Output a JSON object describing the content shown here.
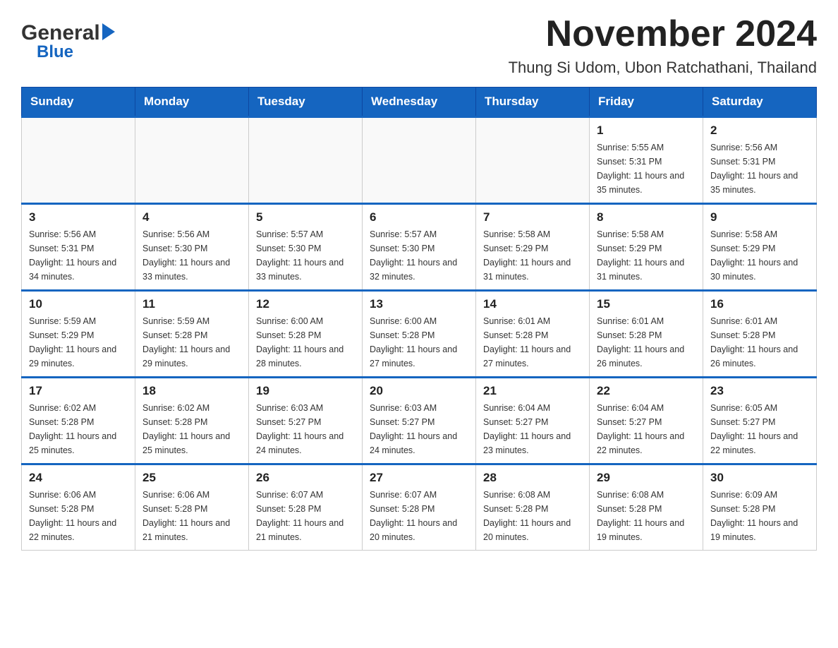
{
  "header": {
    "logo_general": "General",
    "logo_blue": "Blue",
    "title": "November 2024",
    "subtitle": "Thung Si Udom, Ubon Ratchathani, Thailand"
  },
  "calendar": {
    "days_of_week": [
      "Sunday",
      "Monday",
      "Tuesday",
      "Wednesday",
      "Thursday",
      "Friday",
      "Saturday"
    ],
    "weeks": [
      [
        {
          "day": "",
          "info": ""
        },
        {
          "day": "",
          "info": ""
        },
        {
          "day": "",
          "info": ""
        },
        {
          "day": "",
          "info": ""
        },
        {
          "day": "",
          "info": ""
        },
        {
          "day": "1",
          "info": "Sunrise: 5:55 AM\nSunset: 5:31 PM\nDaylight: 11 hours and 35 minutes."
        },
        {
          "day": "2",
          "info": "Sunrise: 5:56 AM\nSunset: 5:31 PM\nDaylight: 11 hours and 35 minutes."
        }
      ],
      [
        {
          "day": "3",
          "info": "Sunrise: 5:56 AM\nSunset: 5:31 PM\nDaylight: 11 hours and 34 minutes."
        },
        {
          "day": "4",
          "info": "Sunrise: 5:56 AM\nSunset: 5:30 PM\nDaylight: 11 hours and 33 minutes."
        },
        {
          "day": "5",
          "info": "Sunrise: 5:57 AM\nSunset: 5:30 PM\nDaylight: 11 hours and 33 minutes."
        },
        {
          "day": "6",
          "info": "Sunrise: 5:57 AM\nSunset: 5:30 PM\nDaylight: 11 hours and 32 minutes."
        },
        {
          "day": "7",
          "info": "Sunrise: 5:58 AM\nSunset: 5:29 PM\nDaylight: 11 hours and 31 minutes."
        },
        {
          "day": "8",
          "info": "Sunrise: 5:58 AM\nSunset: 5:29 PM\nDaylight: 11 hours and 31 minutes."
        },
        {
          "day": "9",
          "info": "Sunrise: 5:58 AM\nSunset: 5:29 PM\nDaylight: 11 hours and 30 minutes."
        }
      ],
      [
        {
          "day": "10",
          "info": "Sunrise: 5:59 AM\nSunset: 5:29 PM\nDaylight: 11 hours and 29 minutes."
        },
        {
          "day": "11",
          "info": "Sunrise: 5:59 AM\nSunset: 5:28 PM\nDaylight: 11 hours and 29 minutes."
        },
        {
          "day": "12",
          "info": "Sunrise: 6:00 AM\nSunset: 5:28 PM\nDaylight: 11 hours and 28 minutes."
        },
        {
          "day": "13",
          "info": "Sunrise: 6:00 AM\nSunset: 5:28 PM\nDaylight: 11 hours and 27 minutes."
        },
        {
          "day": "14",
          "info": "Sunrise: 6:01 AM\nSunset: 5:28 PM\nDaylight: 11 hours and 27 minutes."
        },
        {
          "day": "15",
          "info": "Sunrise: 6:01 AM\nSunset: 5:28 PM\nDaylight: 11 hours and 26 minutes."
        },
        {
          "day": "16",
          "info": "Sunrise: 6:01 AM\nSunset: 5:28 PM\nDaylight: 11 hours and 26 minutes."
        }
      ],
      [
        {
          "day": "17",
          "info": "Sunrise: 6:02 AM\nSunset: 5:28 PM\nDaylight: 11 hours and 25 minutes."
        },
        {
          "day": "18",
          "info": "Sunrise: 6:02 AM\nSunset: 5:28 PM\nDaylight: 11 hours and 25 minutes."
        },
        {
          "day": "19",
          "info": "Sunrise: 6:03 AM\nSunset: 5:27 PM\nDaylight: 11 hours and 24 minutes."
        },
        {
          "day": "20",
          "info": "Sunrise: 6:03 AM\nSunset: 5:27 PM\nDaylight: 11 hours and 24 minutes."
        },
        {
          "day": "21",
          "info": "Sunrise: 6:04 AM\nSunset: 5:27 PM\nDaylight: 11 hours and 23 minutes."
        },
        {
          "day": "22",
          "info": "Sunrise: 6:04 AM\nSunset: 5:27 PM\nDaylight: 11 hours and 22 minutes."
        },
        {
          "day": "23",
          "info": "Sunrise: 6:05 AM\nSunset: 5:27 PM\nDaylight: 11 hours and 22 minutes."
        }
      ],
      [
        {
          "day": "24",
          "info": "Sunrise: 6:06 AM\nSunset: 5:28 PM\nDaylight: 11 hours and 22 minutes."
        },
        {
          "day": "25",
          "info": "Sunrise: 6:06 AM\nSunset: 5:28 PM\nDaylight: 11 hours and 21 minutes."
        },
        {
          "day": "26",
          "info": "Sunrise: 6:07 AM\nSunset: 5:28 PM\nDaylight: 11 hours and 21 minutes."
        },
        {
          "day": "27",
          "info": "Sunrise: 6:07 AM\nSunset: 5:28 PM\nDaylight: 11 hours and 20 minutes."
        },
        {
          "day": "28",
          "info": "Sunrise: 6:08 AM\nSunset: 5:28 PM\nDaylight: 11 hours and 20 minutes."
        },
        {
          "day": "29",
          "info": "Sunrise: 6:08 AM\nSunset: 5:28 PM\nDaylight: 11 hours and 19 minutes."
        },
        {
          "day": "30",
          "info": "Sunrise: 6:09 AM\nSunset: 5:28 PM\nDaylight: 11 hours and 19 minutes."
        }
      ]
    ]
  }
}
